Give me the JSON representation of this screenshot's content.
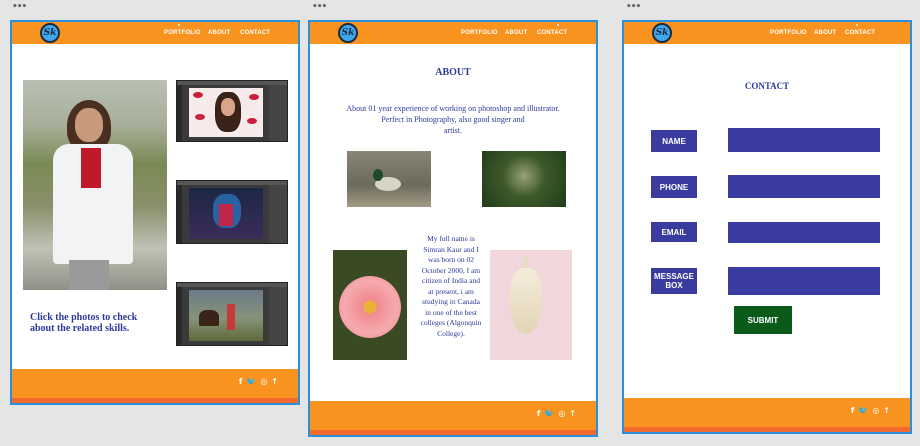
{
  "window_dots": "•••",
  "logo_text": "Sk",
  "nav": {
    "portfolio": "PORTFOLIO",
    "about": "ABOUT",
    "contact": "CONTACT"
  },
  "social": {
    "facebook": "f",
    "twitter": "🐦",
    "instagram": "◎",
    "up": "↑"
  },
  "portfolio": {
    "caption": "Click the photos to check about the related skills."
  },
  "about": {
    "title": "ABOUT",
    "intro_line1": "About 01 year experience of working on photoshop and illustrator.",
    "intro_line2": "Perfect in Photography, also good singer and",
    "intro_line3": "artist.",
    "bio": "My full name is Simran Kaur and I was born on 02 October 2000, I am citizen of India and at present, i am studying in Canada in one of the best colleges (Algonquin College)."
  },
  "contact": {
    "title": "CONTACT",
    "fields": [
      "NAME",
      "PHONE",
      "EMAIL",
      "MESSAGE BOX"
    ],
    "submit": "SUBMIT"
  },
  "colors": {
    "orange": "#f7931e",
    "blue_text": "#2c3a9a",
    "field_blue": "#393c9e",
    "submit_green": "#0a5a1a",
    "selection_blue": "#2a8fdc"
  }
}
